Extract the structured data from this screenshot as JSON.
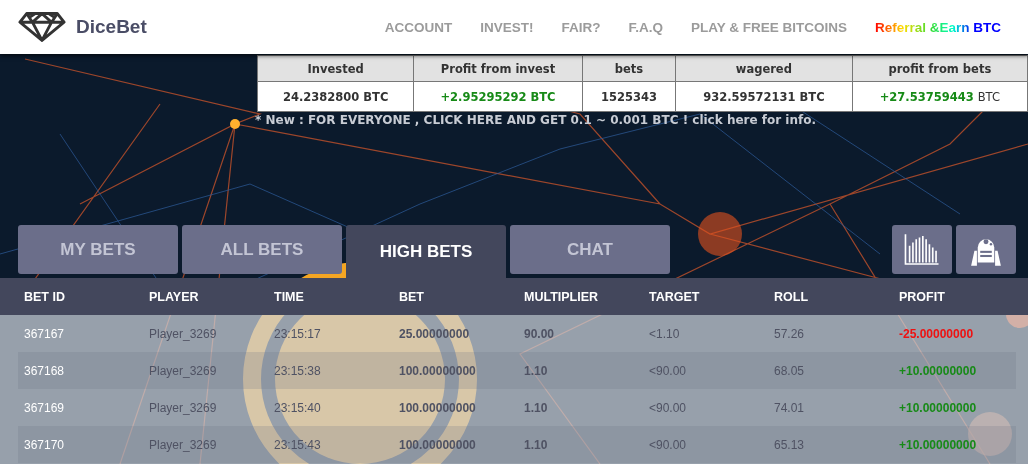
{
  "brand": {
    "name": "DiceBet"
  },
  "nav": [
    {
      "label": "ACCOUNT",
      "kind": "plain"
    },
    {
      "label": "INVEST!",
      "kind": "plain"
    },
    {
      "label": "FAIR?",
      "kind": "plain"
    },
    {
      "label": "F.A.Q",
      "kind": "plain"
    },
    {
      "label": "PLAY & FREE BITCOINS",
      "kind": "plain"
    },
    {
      "label": "Referral &Earn BTC",
      "kind": "rainbow"
    }
  ],
  "stats": [
    {
      "label": "Invested",
      "value": "24.2382800 BTC",
      "positive": false
    },
    {
      "label": "Profit from invest",
      "value": "+2.95295292 BTC",
      "positive": true
    },
    {
      "label": "bets",
      "value": "1525343",
      "positive": false
    },
    {
      "label": "wagered",
      "value": "932.59572131 BTC",
      "positive": false
    },
    {
      "label": "profit from bets",
      "value": "+27.53759443",
      "unit": "BTC",
      "positive": true
    }
  ],
  "notice": "* New : FOR EVERYONE , CLICK HERE AND GET 0.1 ~ 0.001 BTC ! click here for info.",
  "tabs": [
    {
      "label": "MY BETS",
      "selected": false
    },
    {
      "label": "ALL BETS",
      "selected": false
    },
    {
      "label": "HIGH BETS",
      "selected": true
    },
    {
      "label": "CHAT",
      "selected": false
    }
  ],
  "tools": [
    {
      "kind": "stats"
    },
    {
      "kind": "robot"
    }
  ],
  "table": {
    "columns": [
      "BET ID",
      "PLAYER",
      "TIME",
      "BET",
      "MULTIPLIER",
      "TARGET",
      "ROLL",
      "PROFIT"
    ],
    "rows": [
      {
        "cells": [
          "367167",
          "Player_3269",
          "23:15:17",
          "25.00000000",
          "90.00",
          "<1.10",
          "57.26",
          "-25.00000000"
        ],
        "color": "#ee1111"
      },
      {
        "cells": [
          "367168",
          "Player_3269",
          "23:15:38",
          "100.00000000",
          "1.10",
          "<90.00",
          "68.05",
          "+10.00000000"
        ],
        "color": "#178a17"
      },
      {
        "cells": [
          "367169",
          "Player_3269",
          "23:15:40",
          "100.00000000",
          "1.10",
          "<90.00",
          "74.01",
          "+10.00000000"
        ],
        "color": "#178a17"
      },
      {
        "cells": [
          "367170",
          "Player_3269",
          "23:15:43",
          "100.00000000",
          "1.10",
          "<90.00",
          "65.13",
          "+10.00000000"
        ],
        "color": "#178a17"
      }
    ]
  }
}
